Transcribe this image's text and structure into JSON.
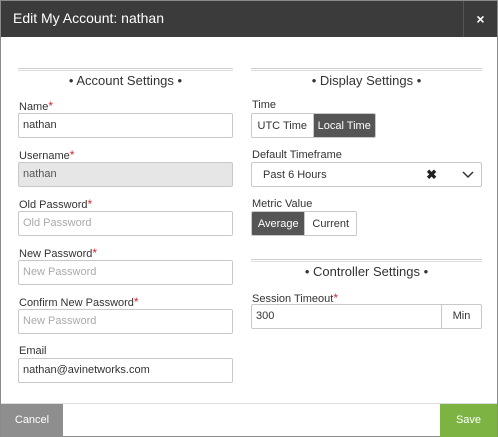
{
  "dialog": {
    "title": "Edit My Account: nathan",
    "close_glyph": "×"
  },
  "account_settings": {
    "heading": "• Account Settings •",
    "required_marker": "*",
    "name": {
      "label": "Name",
      "value": "nathan"
    },
    "username": {
      "label": "Username",
      "value": "nathan"
    },
    "old_password": {
      "label": "Old Password",
      "placeholder": "Old Password"
    },
    "new_password": {
      "label": "New Password",
      "placeholder": "New Password"
    },
    "confirm_password": {
      "label": "Confirm New Password",
      "placeholder": "New Password"
    },
    "email": {
      "label": "Email",
      "value": "nathan@avinetworks.com"
    }
  },
  "display_settings": {
    "heading": "• Display Settings •",
    "time": {
      "label": "Time",
      "options": [
        "UTC Time",
        "Local Time"
      ],
      "selected": "Local Time"
    },
    "timeframe": {
      "label": "Default Timeframe",
      "value": "Past 6 Hours",
      "clear_glyph": "✖"
    },
    "metric_value": {
      "label": "Metric Value",
      "options": [
        "Average",
        "Current"
      ],
      "selected": "Average"
    }
  },
  "controller_settings": {
    "heading": "• Controller Settings •",
    "session_timeout": {
      "label": "Session Timeout",
      "value": "300",
      "unit": "Min"
    }
  },
  "footer": {
    "cancel_label": "Cancel",
    "save_label": "Save"
  },
  "colors": {
    "header_bg": "#3b3b3b",
    "required": "#d9262c",
    "active_segment": "#555555",
    "save_button": "#7cb342",
    "cancel_button": "#8e8e8e"
  },
  "icons": {
    "close": "close-icon",
    "clear": "clear-icon",
    "dropdown": "chevron-down-icon"
  }
}
